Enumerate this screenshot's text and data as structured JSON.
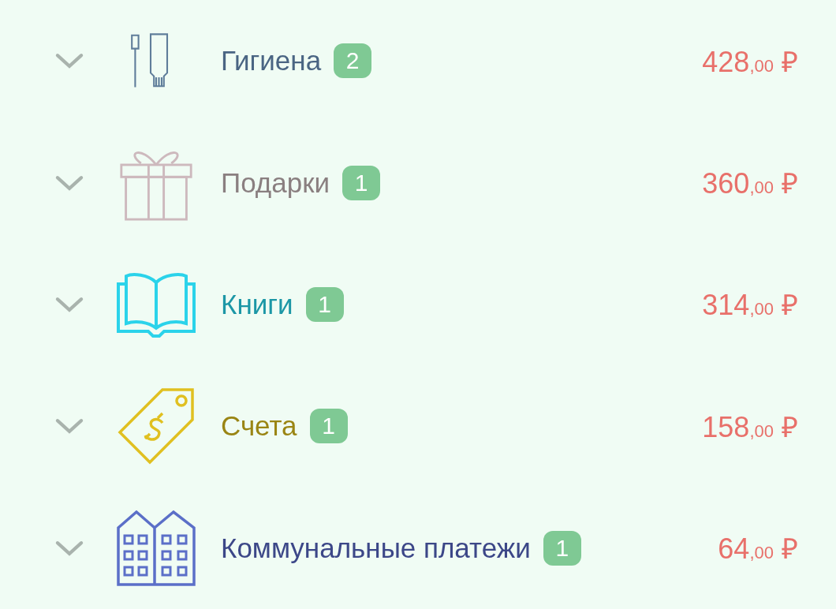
{
  "categories": [
    {
      "kind": "hygiene",
      "name": "Гигиена",
      "color": "#4a6583",
      "count": "2",
      "amount": "428",
      "cents": ",00",
      "currency": "₽"
    },
    {
      "kind": "gift",
      "name": "Подарки",
      "color": "#8a7f80",
      "count": "1",
      "amount": "360",
      "cents": ",00",
      "currency": "₽"
    },
    {
      "kind": "book",
      "name": "Книги",
      "color": "#1c97a6",
      "count": "1",
      "amount": "314",
      "cents": ",00",
      "currency": "₽"
    },
    {
      "kind": "bill",
      "name": "Счета",
      "color": "#9a8514",
      "count": "1",
      "amount": "158",
      "cents": ",00",
      "currency": "₽"
    },
    {
      "kind": "building",
      "name": "Коммунальные платежи",
      "color": "#3c4788",
      "count": "1",
      "amount": "64",
      "cents": ",00",
      "currency": "₽"
    }
  ]
}
